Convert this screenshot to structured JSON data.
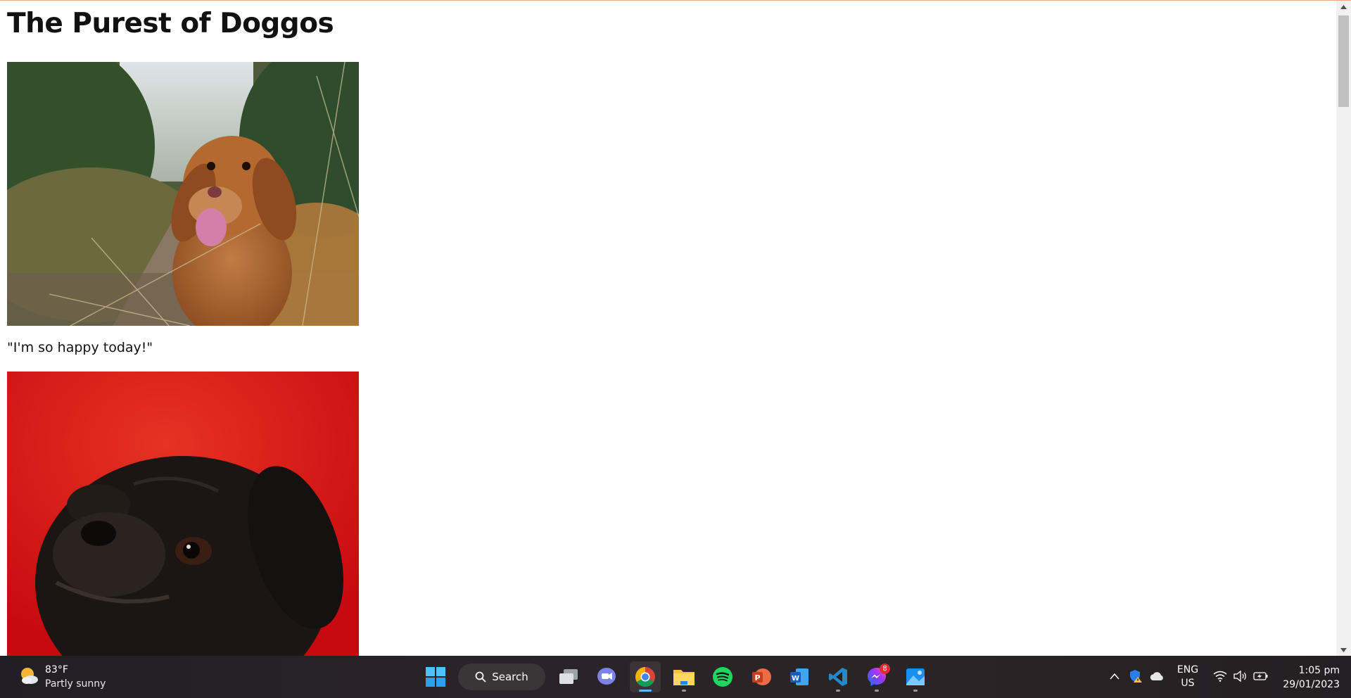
{
  "page": {
    "title": "The Purest of Doggos",
    "posts": [
      {
        "image": "happy-golden-dog-photo",
        "caption": "\"I'm so happy today!\""
      },
      {
        "image": "black-pug-red-background-photo",
        "caption": ""
      }
    ]
  },
  "taskbar": {
    "weather": {
      "temperature": "83°F",
      "condition": "Partly sunny",
      "icon": "sun-cloud-icon"
    },
    "search_label": "Search",
    "apps": [
      {
        "name": "windows-start",
        "active": false
      },
      {
        "name": "task-view",
        "active": false
      },
      {
        "name": "teams-chat",
        "active": false
      },
      {
        "name": "chrome",
        "active": true
      },
      {
        "name": "file-explorer",
        "active": false
      },
      {
        "name": "spotify",
        "active": false
      },
      {
        "name": "powerpoint",
        "active": false
      },
      {
        "name": "word",
        "active": false
      },
      {
        "name": "vscode",
        "active": false
      },
      {
        "name": "messenger",
        "active": false
      },
      {
        "name": "photos",
        "active": false
      }
    ],
    "messenger_badge": "8",
    "language": {
      "line1": "ENG",
      "line2": "US"
    },
    "clock": {
      "time": "1:05 pm",
      "date": "29/01/2023"
    }
  },
  "colors": {
    "taskbar_bg": "#2a2328",
    "accent": "#60b8f5",
    "badge": "#e02b32"
  }
}
